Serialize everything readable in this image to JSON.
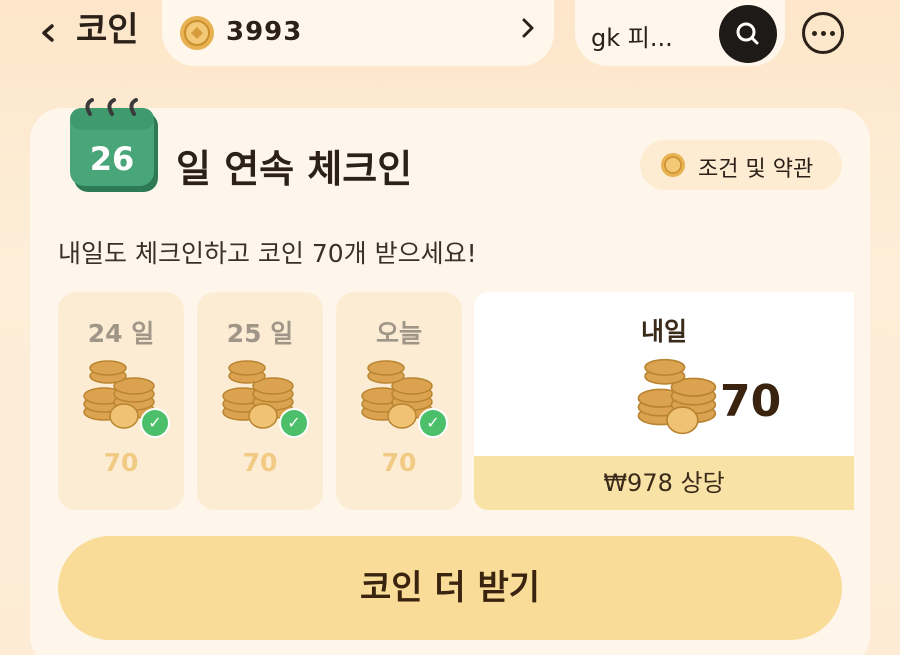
{
  "header": {
    "back_label": "<",
    "title": "코인",
    "coin_balance": "3993",
    "coin_chevron": ">",
    "search_query": "gk 피...",
    "search_icon": "search-icon",
    "more_icon": "more-horizontal-icon"
  },
  "checkin": {
    "calendar_day": "26",
    "streak_title": "일 연속 체크인",
    "terms_label": "조건 및 약관",
    "promo_text": "내일도 체크인하고 코인 70개 받으세요!",
    "days": [
      {
        "label": "24 일",
        "amount": "70",
        "checked": true
      },
      {
        "label": "25 일",
        "amount": "70",
        "checked": true
      },
      {
        "label": "오늘",
        "amount": "70",
        "checked": true
      }
    ],
    "tomorrow": {
      "label": "내일",
      "amount": "70",
      "value_text": "₩978 상당"
    },
    "cta_label": "코인 더 받기"
  },
  "colors": {
    "background": "#fde6c9",
    "card": "#fff6eb",
    "cta": "#f9dc97",
    "calendar_green": "#3f9a6e",
    "check_green": "#4cbf6a",
    "coin_gold": "#e3a94a"
  }
}
